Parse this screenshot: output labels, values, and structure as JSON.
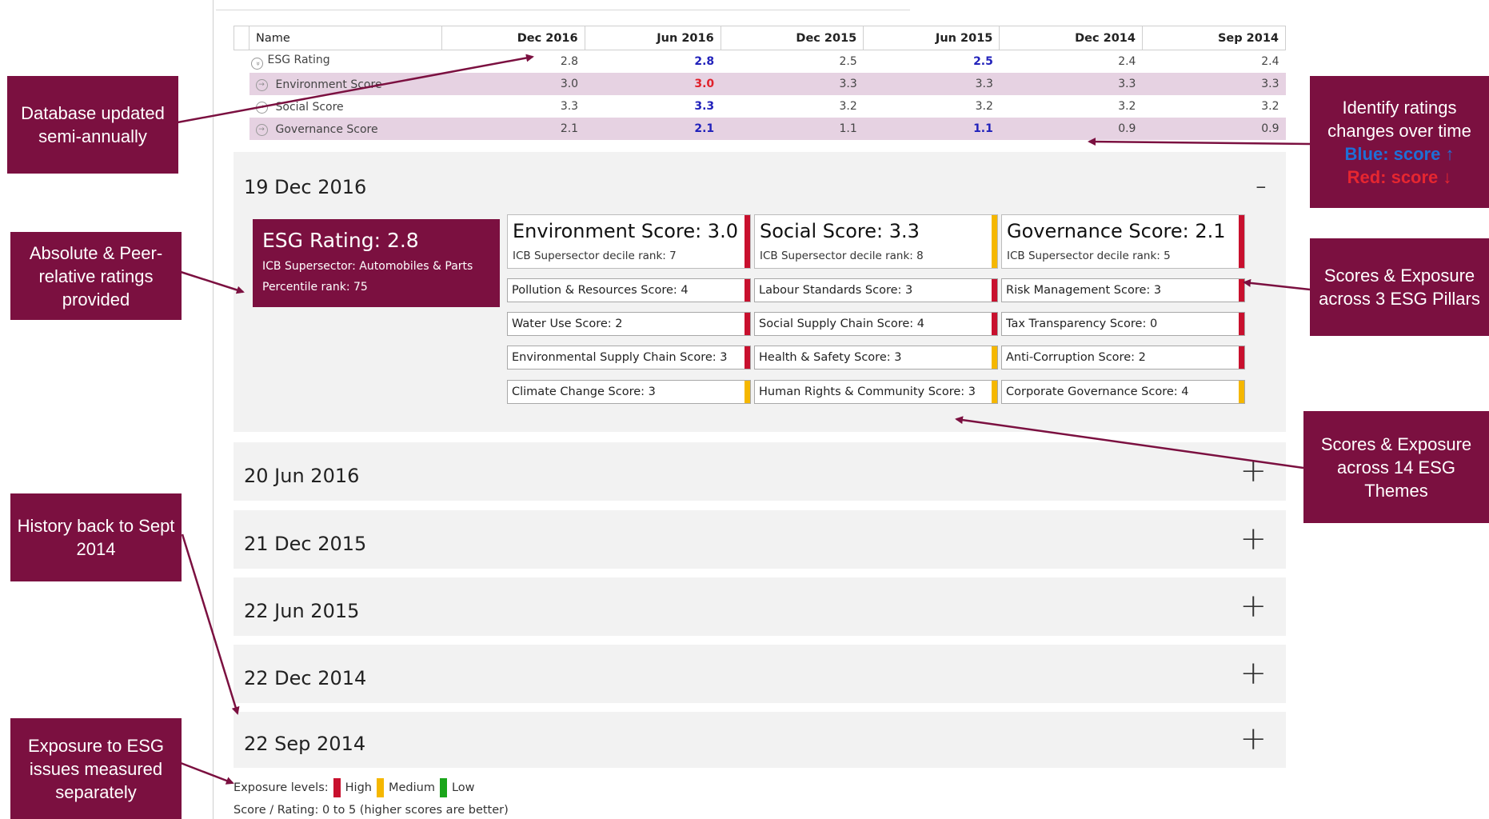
{
  "history_table": {
    "name_header": "Name",
    "columns": [
      "Dec 2016",
      "Jun 2016",
      "Dec 2015",
      "Jun 2015",
      "Dec 2014",
      "Sep 2014"
    ],
    "rows": [
      {
        "name": "ESG Rating",
        "values": [
          "2.8",
          "2.8",
          "2.5",
          "2.5",
          "2.4",
          "2.4"
        ],
        "changes": [
          "",
          "up",
          "",
          "up",
          "",
          ""
        ]
      },
      {
        "name": "Environment Score",
        "values": [
          "3.0",
          "3.0",
          "3.3",
          "3.3",
          "3.3",
          "3.3"
        ],
        "changes": [
          "",
          "down",
          "",
          "",
          "",
          ""
        ]
      },
      {
        "name": "Social Score",
        "values": [
          "3.3",
          "3.3",
          "3.2",
          "3.2",
          "3.2",
          "3.2"
        ],
        "changes": [
          "",
          "up",
          "",
          "",
          "",
          ""
        ]
      },
      {
        "name": "Governance Score",
        "values": [
          "2.1",
          "2.1",
          "1.1",
          "1.1",
          "0.9",
          "0.9"
        ],
        "changes": [
          "",
          "up",
          "",
          "up",
          "",
          ""
        ]
      }
    ]
  },
  "accordion": [
    {
      "date": "19 Dec 2016",
      "toggle": "-",
      "expanded": true
    },
    {
      "date": "20 Jun 2016",
      "toggle": "+",
      "expanded": false
    },
    {
      "date": "21 Dec 2015",
      "toggle": "+",
      "expanded": false
    },
    {
      "date": "22 Jun 2015",
      "toggle": "+",
      "expanded": false
    },
    {
      "date": "22 Dec 2014",
      "toggle": "+",
      "expanded": false
    },
    {
      "date": "22 Sep 2014",
      "toggle": "+",
      "expanded": false
    }
  ],
  "rating": {
    "title": "ESG Rating: 2.8",
    "supersector": "ICB Supersector: Automobiles & Parts",
    "percentile": "Percentile rank: 75"
  },
  "pillars": [
    {
      "title": "Environment Score: 3.0",
      "rank": "ICB Supersector decile rank: 7",
      "exposure": "high",
      "themes": [
        {
          "label": "Pollution & Resources Score: 4",
          "exposure": "high"
        },
        {
          "label": "Water Use Score: 2",
          "exposure": "high"
        },
        {
          "label": "Environmental Supply Chain Score: 3",
          "exposure": "high"
        },
        {
          "label": "Climate Change Score: 3",
          "exposure": "medium"
        }
      ]
    },
    {
      "title": "Social Score: 3.3",
      "rank": "ICB Supersector decile rank: 8",
      "exposure": "medium",
      "themes": [
        {
          "label": "Labour Standards Score: 3",
          "exposure": "high"
        },
        {
          "label": "Social Supply Chain Score: 4",
          "exposure": "high"
        },
        {
          "label": "Health & Safety Score: 3",
          "exposure": "medium"
        },
        {
          "label": "Human Rights & Community Score: 3",
          "exposure": "medium"
        }
      ]
    },
    {
      "title": "Governance Score: 2.1",
      "rank": "ICB Supersector decile rank: 5",
      "exposure": "high",
      "themes": [
        {
          "label": "Risk Management Score: 3",
          "exposure": "high"
        },
        {
          "label": "Tax Transparency Score: 0",
          "exposure": "high"
        },
        {
          "label": "Anti-Corruption Score: 2",
          "exposure": "high"
        },
        {
          "label": "Corporate Governance Score: 4",
          "exposure": "medium"
        }
      ]
    }
  ],
  "legend": {
    "prefix": "Exposure levels:",
    "high": "High",
    "medium": "Medium",
    "low": "Low"
  },
  "footnote": "Score / Rating: 0 to 5 (higher scores are better)",
  "colors": {
    "brand": "#7b1040",
    "high": "#c8102e",
    "medium": "#f5b700",
    "low": "#1aa51a",
    "up": "#2222bb",
    "down": "#e0202a",
    "row_shade": "#e6d2e2",
    "panel": "#f2f2f2"
  },
  "callouts": {
    "database": "Database updated semi-annually",
    "identify": "Identify ratings changes over time",
    "identify_blue": "Blue: score ↑",
    "identify_red": "Red: score ↓",
    "absolute": "Absolute & Peer-relative ratings provided",
    "pillars": "Scores & Exposure across 3 ESG Pillars",
    "themes": "Scores & Exposure across 14 ESG Themes",
    "history": "History back to Sept 2014",
    "exposure": "Exposure to ESG issues measured separately"
  }
}
